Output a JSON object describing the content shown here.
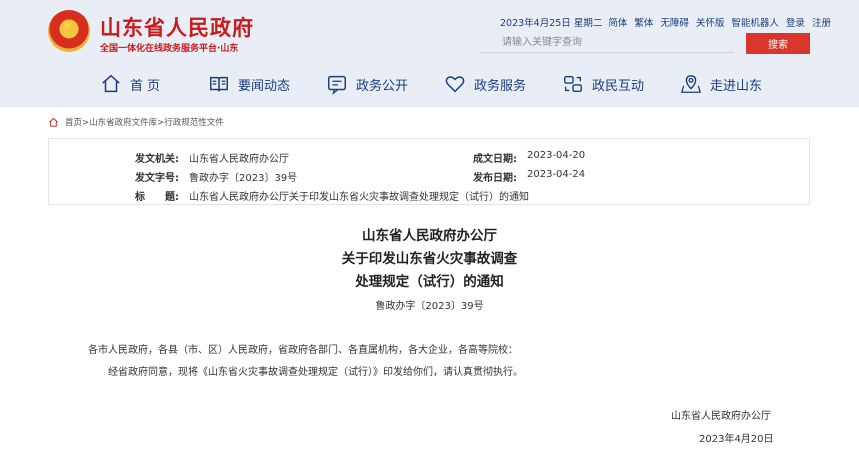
{
  "header": {
    "title": "山东省人民政府",
    "subtitle": "全国一体化在线政务服务平台·山东",
    "date": "2023年4月25日 星期二",
    "links": [
      "简体",
      "繁体",
      "无障碍",
      "关怀版",
      "智能机器人",
      "登录",
      "注册"
    ],
    "search_placeholder": "请输入关键字查询",
    "search_button": "搜索"
  },
  "nav": {
    "items": [
      {
        "label": "首 页",
        "icon": "home-icon"
      },
      {
        "label": "要闻动态",
        "icon": "news-book-icon"
      },
      {
        "label": "政务公开",
        "icon": "message-window-icon"
      },
      {
        "label": "政务服务",
        "icon": "heart-icon"
      },
      {
        "label": "政民互动",
        "icon": "interaction-icon"
      },
      {
        "label": "走进山东",
        "icon": "location-map-icon"
      }
    ]
  },
  "breadcrumb": {
    "icon": "home-icon",
    "text": "首页>山东省政府文件库>行政规范性文件"
  },
  "meta": {
    "issuer_label": "发文机关:",
    "issuer": "山东省人民政府办公厅",
    "created_label": "成文日期:",
    "created": "2023-04-20",
    "docno_label": "发文字号:",
    "docno": "鲁政办字〔2023〕39号",
    "published_label": "发布日期:",
    "published": "2023-04-24",
    "title_label": "标　　题:",
    "title": "山东省人民政府办公厅关于印发山东省火灾事故调查处理规定（试行）的通知"
  },
  "document": {
    "title_lines": [
      "山东省人民政府办公厅",
      "关于印发山东省火灾事故调查",
      "处理规定（试行）的通知"
    ],
    "doc_number": "鲁政办字〔2023〕39号",
    "addressees": "各市人民政府，各县（市、区）人民政府，省政府各部门、各直属机构，各大企业，各高等院校：",
    "body": "经省政府同意，现将《山东省火灾事故调查处理规定（试行）》印发给你们，请认真贯彻执行。",
    "signature": "山东省人民政府办公厅",
    "sign_date": "2023年4月20日"
  },
  "colors": {
    "brand_red": "#c81b1b",
    "nav_blue": "#1a3d7c",
    "header_bg": "#e9eef6",
    "search_button": "#d9372b"
  }
}
